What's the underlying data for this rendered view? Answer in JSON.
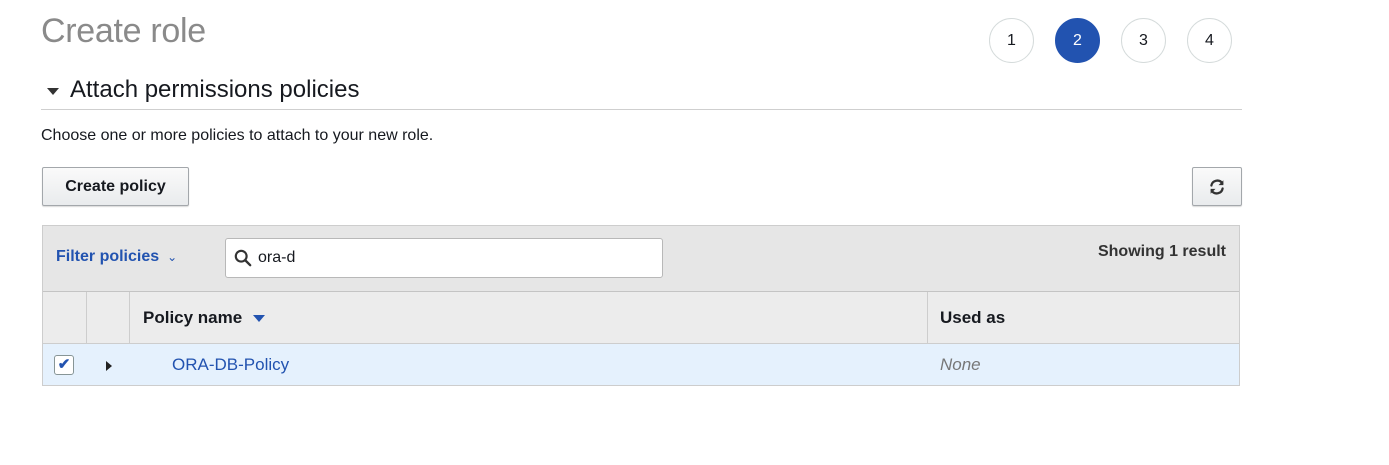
{
  "page": {
    "title": "Create role"
  },
  "steps": [
    {
      "label": "1",
      "active": false
    },
    {
      "label": "2",
      "active": true
    },
    {
      "label": "3",
      "active": false
    },
    {
      "label": "4",
      "active": false
    }
  ],
  "section": {
    "title": "Attach permissions policies",
    "description": "Choose one or more policies to attach to your new role."
  },
  "toolbar": {
    "create_policy_label": "Create policy",
    "refresh_icon": "refresh-icon"
  },
  "filter": {
    "label": "Filter policies",
    "search_value": "ora-d",
    "result_count": "Showing 1 result"
  },
  "table": {
    "columns": [
      "Policy name",
      "Used as"
    ],
    "rows": [
      {
        "checked": true,
        "policy_name": "ORA-DB-Policy",
        "used_as": "None"
      }
    ]
  },
  "colors": {
    "accent": "#2253b0",
    "selected_row": "#e5f1fd"
  }
}
